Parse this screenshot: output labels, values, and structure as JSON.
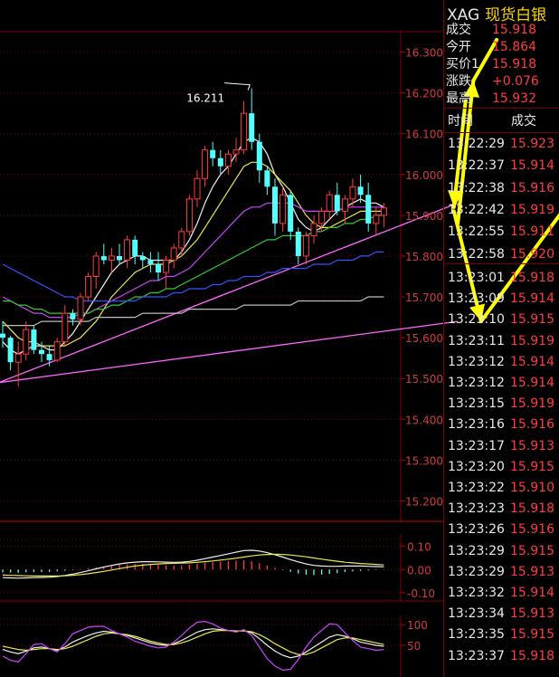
{
  "quote": {
    "symbol": "XAG",
    "name": "现货白银",
    "fields": [
      {
        "label": "成交",
        "value": "15.918"
      },
      {
        "label": "今开",
        "value": "15.864"
      },
      {
        "label": "买价1",
        "value": "15.918"
      },
      {
        "label": "涨跌",
        "value": "+0.076"
      },
      {
        "label": "最高",
        "value": "15.932"
      }
    ]
  },
  "ticks": {
    "header_time": "时间",
    "header_price": "成交",
    "rows": [
      {
        "time": "13:22:29",
        "price": "15.923"
      },
      {
        "time": "13:22:37",
        "price": "15.914"
      },
      {
        "time": "13:22:38",
        "price": "15.916"
      },
      {
        "time": "13:22:42",
        "price": "15.919"
      },
      {
        "time": "13:22:55",
        "price": "15.911"
      },
      {
        "time": "13:22:58",
        "price": "15.920"
      },
      {
        "time": "13:23:01",
        "price": "15.918"
      },
      {
        "time": "13:23:09",
        "price": "15.914"
      },
      {
        "time": "13:23:10",
        "price": "15.915"
      },
      {
        "time": "13:23:11",
        "price": "15.919"
      },
      {
        "time": "13:23:12",
        "price": "15.914"
      },
      {
        "time": "13:23:12",
        "price": "15.914"
      },
      {
        "time": "13:23:15",
        "price": "15.919"
      },
      {
        "time": "13:23:16",
        "price": "15.916"
      },
      {
        "time": "13:23:17",
        "price": "15.913"
      },
      {
        "time": "13:23:20",
        "price": "15.915"
      },
      {
        "time": "13:23:22",
        "price": "15.910"
      },
      {
        "time": "13:23:23",
        "price": "15.918"
      },
      {
        "time": "13:23:26",
        "price": "15.916"
      },
      {
        "time": "13:23:29",
        "price": "15.915"
      },
      {
        "time": "13:23:29",
        "price": "15.913"
      },
      {
        "time": "13:23:32",
        "price": "15.914"
      },
      {
        "time": "13:23:34",
        "price": "15.913"
      },
      {
        "time": "13:23:35",
        "price": "15.915"
      },
      {
        "time": "13:23:37",
        "price": "15.918"
      }
    ]
  },
  "chart_data": {
    "type": "candlestick",
    "price_axis": {
      "ticks": [
        "16.300",
        "16.200",
        "16.100",
        "16.000",
        "15.900",
        "15.800",
        "15.700",
        "15.600",
        "15.500",
        "15.400",
        "15.300",
        "15.200"
      ],
      "ylim": [
        15.15,
        16.33
      ]
    },
    "peak_annotation": {
      "label": "16.211",
      "value": 16.211
    },
    "candles": [
      [
        15.61,
        15.64,
        15.575,
        15.6
      ],
      [
        15.6,
        15.605,
        15.52,
        15.54
      ],
      [
        15.54,
        15.59,
        15.48,
        15.56
      ],
      [
        15.56,
        15.64,
        15.545,
        15.62
      ],
      [
        15.62,
        15.63,
        15.56,
        15.57
      ],
      [
        15.57,
        15.59,
        15.54,
        15.56
      ],
      [
        15.56,
        15.58,
        15.53,
        15.545
      ],
      [
        15.545,
        15.6,
        15.54,
        15.59
      ],
      [
        15.59,
        15.68,
        15.58,
        15.66
      ],
      [
        15.66,
        15.67,
        15.63,
        15.645
      ],
      [
        15.645,
        15.71,
        15.63,
        15.7
      ],
      [
        15.7,
        15.76,
        15.69,
        15.75
      ],
      [
        15.75,
        15.81,
        15.72,
        15.8
      ],
      [
        15.8,
        15.83,
        15.78,
        15.79
      ],
      [
        15.79,
        15.82,
        15.76,
        15.8
      ],
      [
        15.8,
        15.83,
        15.78,
        15.79
      ],
      [
        15.79,
        15.85,
        15.77,
        15.84
      ],
      [
        15.84,
        15.85,
        15.78,
        15.8
      ],
      [
        15.8,
        15.81,
        15.77,
        15.79
      ],
      [
        15.79,
        15.81,
        15.76,
        15.78
      ],
      [
        15.78,
        15.81,
        15.74,
        15.76
      ],
      [
        15.76,
        15.8,
        15.72,
        15.79
      ],
      [
        15.79,
        15.83,
        15.77,
        15.82
      ],
      [
        15.82,
        15.87,
        15.8,
        15.86
      ],
      [
        15.86,
        15.95,
        15.85,
        15.94
      ],
      [
        15.94,
        16.01,
        15.92,
        15.99
      ],
      [
        15.99,
        16.07,
        15.97,
        16.06
      ],
      [
        16.06,
        16.08,
        16.02,
        16.04
      ],
      [
        16.04,
        16.06,
        16.0,
        16.02
      ],
      [
        16.02,
        16.06,
        16.0,
        16.05
      ],
      [
        16.05,
        16.09,
        16.03,
        16.06
      ],
      [
        16.06,
        16.18,
        16.05,
        16.15
      ],
      [
        16.15,
        16.211,
        16.06,
        16.08
      ],
      [
        16.08,
        16.1,
        15.98,
        16.01
      ],
      [
        16.01,
        16.02,
        15.95,
        15.97
      ],
      [
        15.97,
        15.99,
        15.85,
        15.88
      ],
      [
        15.88,
        15.97,
        15.86,
        15.95
      ],
      [
        15.95,
        15.96,
        15.84,
        15.86
      ],
      [
        15.86,
        15.87,
        15.78,
        15.8
      ],
      [
        15.8,
        15.86,
        15.78,
        15.85
      ],
      [
        15.85,
        15.9,
        15.83,
        15.88
      ],
      [
        15.88,
        15.92,
        15.86,
        15.91
      ],
      [
        15.91,
        15.96,
        15.89,
        15.95
      ],
      [
        15.95,
        15.98,
        15.9,
        15.91
      ],
      [
        15.91,
        15.95,
        15.88,
        15.94
      ],
      [
        15.94,
        15.99,
        15.92,
        15.97
      ],
      [
        15.97,
        16.0,
        15.93,
        15.95
      ],
      [
        15.95,
        15.98,
        15.86,
        15.88
      ],
      [
        15.88,
        15.92,
        15.85,
        15.9
      ],
      [
        15.9,
        15.93,
        15.87,
        15.918
      ]
    ],
    "ma_lines": [
      {
        "color": "#f0f0f0",
        "values": [
          15.59,
          15.57,
          15.56,
          15.57,
          15.58,
          15.58,
          15.57,
          15.57,
          15.59,
          15.61,
          15.64,
          15.67,
          15.7,
          15.73,
          15.76,
          15.78,
          15.79,
          15.8,
          15.8,
          15.79,
          15.79,
          15.79,
          15.79,
          15.81,
          15.84,
          15.88,
          15.93,
          15.97,
          16.0,
          16.02,
          16.05,
          16.08,
          16.09,
          16.08,
          16.05,
          16.0,
          15.97,
          15.93,
          15.89,
          15.87,
          15.86,
          15.87,
          15.89,
          15.91,
          15.92,
          15.93,
          15.94,
          15.93,
          15.93,
          15.92
        ]
      },
      {
        "color": "#e8e84a",
        "values": [
          15.64,
          15.62,
          15.6,
          15.59,
          15.59,
          15.58,
          15.58,
          15.58,
          15.58,
          15.59,
          15.6,
          15.62,
          15.64,
          15.67,
          15.7,
          15.72,
          15.74,
          15.76,
          15.77,
          15.78,
          15.78,
          15.78,
          15.79,
          15.8,
          15.82,
          15.84,
          15.87,
          15.9,
          15.93,
          15.96,
          15.99,
          16.02,
          16.03,
          16.03,
          16.02,
          16.0,
          15.98,
          15.96,
          15.93,
          15.9,
          15.88,
          15.87,
          15.87,
          15.88,
          15.89,
          15.9,
          15.91,
          15.91,
          15.91,
          15.91
        ]
      },
      {
        "color": "#cc44ff",
        "values": [
          15.7,
          15.69,
          15.68,
          15.67,
          15.66,
          15.66,
          15.65,
          15.65,
          15.65,
          15.65,
          15.66,
          15.66,
          15.67,
          15.68,
          15.69,
          15.7,
          15.71,
          15.72,
          15.73,
          15.74,
          15.74,
          15.75,
          15.75,
          15.76,
          15.77,
          15.79,
          15.81,
          15.83,
          15.85,
          15.87,
          15.89,
          15.91,
          15.92,
          15.92,
          15.93,
          15.93,
          15.93,
          15.93,
          15.92,
          15.91,
          15.91,
          15.91,
          15.91,
          15.91,
          15.92,
          15.92,
          15.92,
          15.92,
          15.92,
          15.92
        ]
      },
      {
        "color": "#33cc33",
        "values": [
          15.69,
          15.69,
          15.68,
          15.68,
          15.67,
          15.67,
          15.66,
          15.66,
          15.66,
          15.66,
          15.66,
          15.66,
          15.67,
          15.67,
          15.68,
          15.68,
          15.69,
          15.7,
          15.7,
          15.71,
          15.71,
          15.72,
          15.72,
          15.73,
          15.74,
          15.75,
          15.76,
          15.77,
          15.78,
          15.79,
          15.8,
          15.81,
          15.82,
          15.83,
          15.84,
          15.84,
          15.85,
          15.85,
          15.85,
          15.85,
          15.86,
          15.86,
          15.87,
          15.87,
          15.88,
          15.88,
          15.89,
          15.89,
          15.9,
          15.9
        ]
      },
      {
        "color": "#3355ff",
        "values": [
          15.78,
          15.77,
          15.76,
          15.75,
          15.74,
          15.73,
          15.72,
          15.71,
          15.7,
          15.7,
          15.69,
          15.69,
          15.69,
          15.69,
          15.69,
          15.69,
          15.69,
          15.69,
          15.7,
          15.7,
          15.7,
          15.7,
          15.71,
          15.71,
          15.72,
          15.72,
          15.72,
          15.73,
          15.73,
          15.74,
          15.74,
          15.75,
          15.75,
          15.75,
          15.76,
          15.76,
          15.77,
          15.77,
          15.77,
          15.77,
          15.78,
          15.78,
          15.78,
          15.79,
          15.79,
          15.79,
          15.8,
          15.8,
          15.81,
          15.81
        ]
      },
      {
        "color": "#bdbdbd",
        "values": [
          15.63,
          15.63,
          15.63,
          15.63,
          15.63,
          15.64,
          15.64,
          15.64,
          15.64,
          15.64,
          15.64,
          15.64,
          15.65,
          15.65,
          15.65,
          15.65,
          15.65,
          15.65,
          15.66,
          15.66,
          15.66,
          15.66,
          15.66,
          15.66,
          15.67,
          15.67,
          15.67,
          15.67,
          15.67,
          15.67,
          15.67,
          15.68,
          15.68,
          15.68,
          15.68,
          15.68,
          15.68,
          15.68,
          15.69,
          15.69,
          15.69,
          15.69,
          15.69,
          15.69,
          15.69,
          15.69,
          15.69,
          15.7,
          15.7,
          15.7
        ]
      }
    ],
    "trendlines": [
      {
        "color": "#ff66ff",
        "from": [
          -0.5,
          15.49
        ],
        "to": [
          58.5,
          15.93
        ]
      },
      {
        "color": "#ff66ff",
        "from": [
          -0.5,
          15.49
        ],
        "to": [
          58.5,
          15.64
        ]
      }
    ],
    "projection_arrows": {
      "color": "#ffff00",
      "path": [
        [
          60.5,
          16.23
        ],
        [
          68.5,
          16.42
        ],
        [
          58.0,
          15.92
        ],
        [
          61.5,
          15.64
        ],
        [
          73.5,
          15.95
        ]
      ]
    },
    "macd": {
      "ticks": [
        "0.10",
        "0.00",
        "-0.10"
      ],
      "ylim": [
        -0.12,
        0.13
      ],
      "histogram": [
        -0.012,
        -0.013,
        -0.014,
        -0.012,
        -0.011,
        -0.011,
        -0.01,
        -0.008,
        -0.005,
        -0.002,
        0.002,
        0.006,
        0.01,
        0.014,
        0.018,
        0.021,
        0.023,
        0.024,
        0.024,
        0.022,
        0.02,
        0.018,
        0.017,
        0.018,
        0.021,
        0.025,
        0.029,
        0.032,
        0.034,
        0.036,
        0.038,
        0.04,
        0.036,
        0.028,
        0.018,
        0.008,
        -0.002,
        -0.01,
        -0.017,
        -0.022,
        -0.024,
        -0.022,
        -0.019,
        -0.015,
        -0.011,
        -0.008,
        -0.006,
        -0.004,
        -0.002,
        -0.001
      ],
      "dif": [
        -0.035,
        -0.036,
        -0.037,
        -0.036,
        -0.035,
        -0.034,
        -0.033,
        -0.03,
        -0.026,
        -0.02,
        -0.013,
        -0.005,
        0.003,
        0.011,
        0.018,
        0.024,
        0.029,
        0.032,
        0.034,
        0.034,
        0.033,
        0.032,
        0.031,
        0.032,
        0.035,
        0.04,
        0.047,
        0.054,
        0.061,
        0.068,
        0.075,
        0.082,
        0.083,
        0.08,
        0.073,
        0.064,
        0.054,
        0.043,
        0.033,
        0.024,
        0.018,
        0.015,
        0.014,
        0.014,
        0.015,
        0.015,
        0.015,
        0.014,
        0.013,
        0.012
      ],
      "dea": [
        -0.024,
        -0.025,
        -0.026,
        -0.027,
        -0.028,
        -0.028,
        -0.028,
        -0.028,
        -0.027,
        -0.025,
        -0.022,
        -0.018,
        -0.013,
        -0.008,
        -0.002,
        0.004,
        0.01,
        0.015,
        0.019,
        0.022,
        0.024,
        0.026,
        0.027,
        0.028,
        0.029,
        0.031,
        0.034,
        0.037,
        0.041,
        0.045,
        0.049,
        0.054,
        0.059,
        0.063,
        0.065,
        0.066,
        0.065,
        0.063,
        0.059,
        0.055,
        0.05,
        0.045,
        0.04,
        0.036,
        0.032,
        0.029,
        0.026,
        0.024,
        0.022,
        0.02
      ]
    },
    "kdj": {
      "ticks": [
        "100",
        "50"
      ],
      "ylim": [
        -20,
        118
      ],
      "k": [
        40,
        34,
        30,
        36,
        44,
        46,
        42,
        38,
        46,
        58,
        66,
        74,
        80,
        84,
        82,
        78,
        74,
        68,
        62,
        56,
        52,
        50,
        54,
        62,
        72,
        82,
        88,
        90,
        88,
        86,
        84,
        86,
        80,
        66,
        50,
        36,
        26,
        20,
        24,
        34,
        46,
        58,
        70,
        76,
        72,
        66,
        58,
        54,
        50,
        48
      ],
      "d": [
        48,
        44,
        40,
        38,
        40,
        42,
        42,
        40,
        42,
        48,
        56,
        64,
        72,
        78,
        80,
        78,
        76,
        72,
        66,
        60,
        56,
        52,
        52,
        56,
        62,
        70,
        78,
        84,
        86,
        86,
        85,
        85,
        83,
        76,
        66,
        54,
        44,
        34,
        28,
        28,
        34,
        44,
        54,
        64,
        68,
        68,
        64,
        60,
        56,
        52
      ],
      "j": [
        24,
        14,
        10,
        30,
        52,
        54,
        42,
        34,
        54,
        78,
        86,
        94,
        96,
        96,
        86,
        78,
        70,
        60,
        54,
        48,
        44,
        46,
        58,
        74,
        92,
        106,
        108,
        102,
        92,
        86,
        82,
        88,
        74,
        46,
        18,
        0,
        -10,
        -8,
        16,
        46,
        70,
        86,
        102,
        100,
        80,
        62,
        46,
        42,
        38,
        40
      ]
    }
  }
}
